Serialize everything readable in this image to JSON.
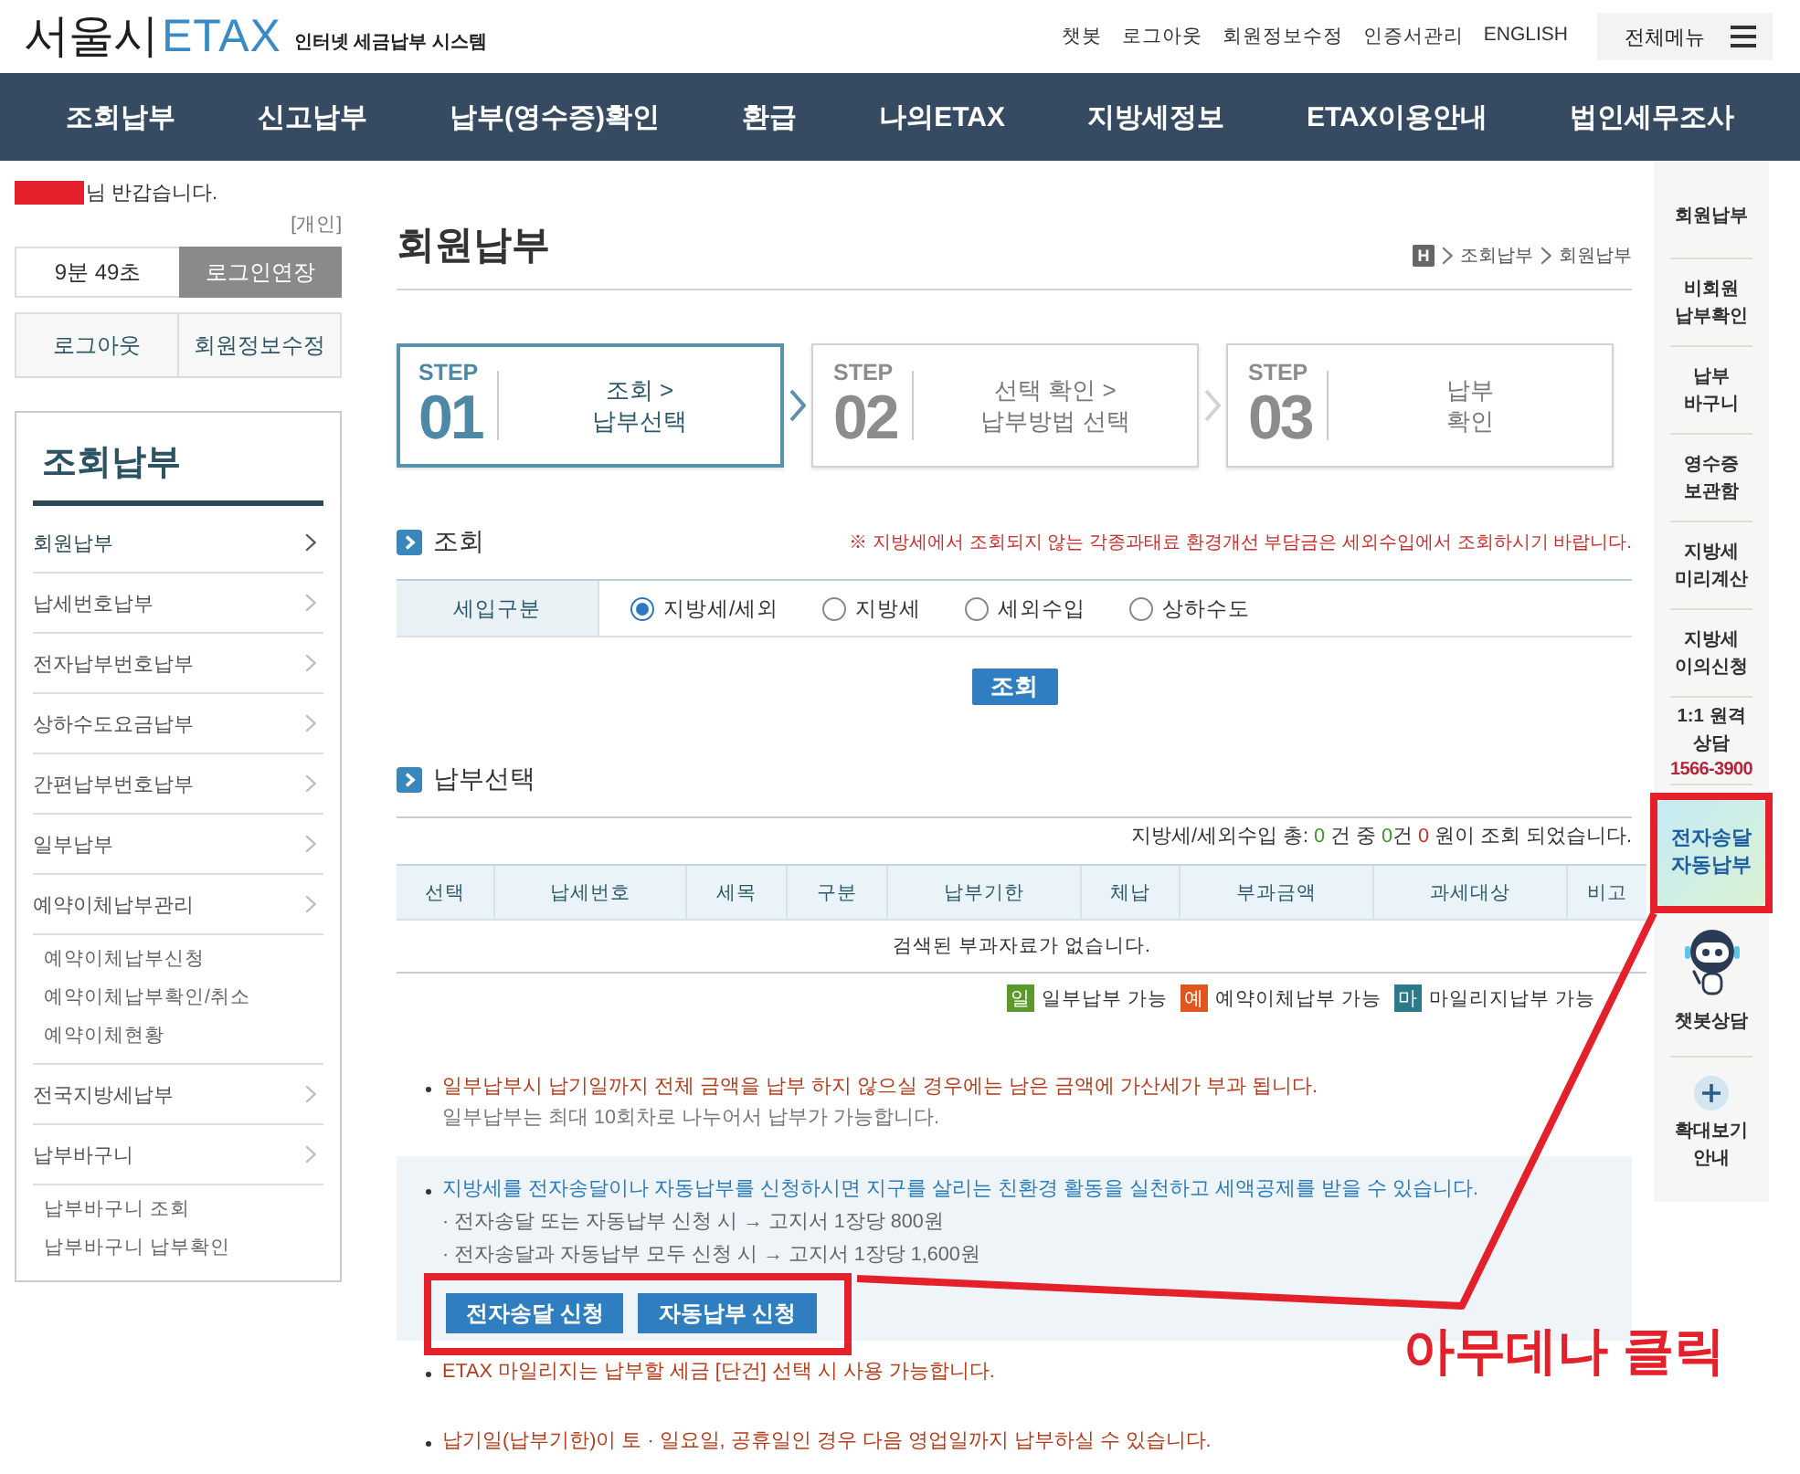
{
  "header": {
    "logo": {
      "city": "서울시",
      "brand": "ETAX"
    },
    "tagline": "인터넷 세금납부 시스템",
    "links": [
      "챗봇",
      "로그아웃",
      "회원정보수정",
      "인증서관리",
      "ENGLISH"
    ],
    "menu_button": "전체메뉴"
  },
  "nav": [
    "조회납부",
    "신고납부",
    "납부(영수증)확인",
    "환급",
    "나의ETAX",
    "지방세정보",
    "ETAX이용안내",
    "법인세무조사"
  ],
  "sidebar": {
    "greeting": "님 반갑습니다.",
    "user_type": "[개인]",
    "timer": "9분 49초",
    "extend_button": "로그인연장",
    "account_buttons": [
      "로그아웃",
      "회원정보수정"
    ],
    "menu_title": "조회납부",
    "items": [
      {
        "label": "회원납부",
        "selected": true
      },
      {
        "label": "납세번호납부",
        "selected": false
      },
      {
        "label": "전자납부번호납부",
        "selected": false
      },
      {
        "label": "상하수도요금납부",
        "selected": false
      },
      {
        "label": "간편납부번호납부",
        "selected": false
      },
      {
        "label": "일부납부",
        "selected": false
      },
      {
        "label": "예약이체납부관리",
        "selected": false,
        "children": [
          {
            "label": "예약이체납부신청"
          },
          {
            "label": "예약이체납부확인/취소"
          },
          {
            "label": "예약이체현황"
          }
        ]
      },
      {
        "label": "전국지방세납부",
        "selected": false
      },
      {
        "label": "납부바구니",
        "selected": false,
        "children": [
          {
            "label": "납부바구니 조회"
          },
          {
            "label": "납부바구니 납부확인"
          }
        ]
      }
    ]
  },
  "main": {
    "title": "회원납부",
    "breadcrumb": {
      "home": "H",
      "items": [
        "조회납부",
        "회원납부"
      ]
    },
    "steps": [
      {
        "tag": "STEP",
        "number": "01",
        "lines": [
          "조회 >",
          "납부선택"
        ],
        "selected": true
      },
      {
        "tag": "STEP",
        "number": "02",
        "lines": [
          "선택 확인 >",
          "납부방법 선택"
        ],
        "selected": false
      },
      {
        "tag": "STEP",
        "number": "03",
        "lines": [
          "납부",
          "확인"
        ],
        "selected": false
      }
    ],
    "inquiry": {
      "title": "조회",
      "notice": "※ 지방세에서 조회되지 않는 각종과태료 환경개선 부담금은 세외수입에서 조회하시기 바랍니다.",
      "field_label": "세입구분",
      "options": [
        {
          "label": "지방세/세외",
          "selected": true
        },
        {
          "label": "지방세",
          "selected": false
        },
        {
          "label": "세외수입",
          "selected": false
        },
        {
          "label": "상하수도",
          "selected": false
        }
      ],
      "button": "조회"
    },
    "payment": {
      "title": "납부선택",
      "summary": [
        {
          "kind": "text",
          "text": "지방세/세외수입 총: "
        },
        {
          "kind": "count",
          "text": "0"
        },
        {
          "kind": "text",
          "text": " 건 중 "
        },
        {
          "kind": "count",
          "text": "0"
        },
        {
          "kind": "text",
          "text": "건 "
        },
        {
          "kind": "amount",
          "text": "0"
        },
        {
          "kind": "text",
          "text": " 원이 조회 되었습니다."
        }
      ],
      "columns": [
        "선택",
        "납세번호",
        "세목",
        "구분",
        "납부기한",
        "체납",
        "부과금액",
        "과세대상",
        "비고"
      ],
      "empty_message": "검색된 부과자료가 없습니다.",
      "legend": [
        {
          "badge": "일",
          "label": "일부납부 가능",
          "color": "#5b9a2a"
        },
        {
          "badge": "예",
          "label": "예약이체납부 가능",
          "color": "#e0561f"
        },
        {
          "badge": "마",
          "label": "마일리지납부 가능",
          "color": "#2a7a8c"
        }
      ]
    },
    "notices": [
      {
        "kind": "warning",
        "text": "일부납부시 납기일까지 전체 금액을 납부 하지 않으실 경우에는 남은 금액에 가산세가 부과 됩니다.",
        "note": "일부납부는 최대 10회차로 나누어서 납부가 가능합니다."
      },
      {
        "kind": "promo",
        "text": "지방세를 전자송달이나 자동납부를 신청하시면 지구를 살리는 친환경 활동을 실천하고 세액공제를 받을 수 있습니다.",
        "details": [
          "· 전자송달 또는 자동납부 신청 시 → 고지서 1장당 800원",
          "· 전자송달과 자동납부 모두 신청 시 → 고지서 1장당 1,600원"
        ],
        "buttons": [
          "전자송달 신청",
          "자동납부 신청"
        ],
        "annotated": true
      },
      {
        "kind": "warning",
        "text": "ETAX 마일리지는 납부할 세금 [단건] 선택 시 사용 가능합니다."
      },
      {
        "kind": "warning",
        "text": "납기일(납부기한)이 토 · 일요일, 공휴일인 경우 다음 영업일까지 납부하실 수 있습니다."
      }
    ]
  },
  "quick_menu": [
    {
      "kind": "link",
      "lines": [
        "회원납부"
      ]
    },
    {
      "kind": "link",
      "lines": [
        "비회원",
        "납부확인"
      ]
    },
    {
      "kind": "link",
      "lines": [
        "납부",
        "바구니"
      ]
    },
    {
      "kind": "link",
      "lines": [
        "영수증",
        "보관함"
      ]
    },
    {
      "kind": "link",
      "lines": [
        "지방세",
        "미리계산"
      ]
    },
    {
      "kind": "link",
      "lines": [
        "지방세",
        "이의신청"
      ]
    },
    {
      "kind": "contact",
      "lines": [
        "1:1 원격",
        "상담"
      ],
      "phone": "1566-3900"
    },
    {
      "kind": "featured",
      "lines": [
        "전자송달",
        "자동납부"
      ],
      "annotated": true
    },
    {
      "kind": "chatbot",
      "lines": [
        "챗봇상담"
      ]
    },
    {
      "kind": "zoom",
      "lines": [
        "확대보기",
        "안내"
      ]
    }
  ],
  "annotation": {
    "text": "아무데나 클릭"
  }
}
